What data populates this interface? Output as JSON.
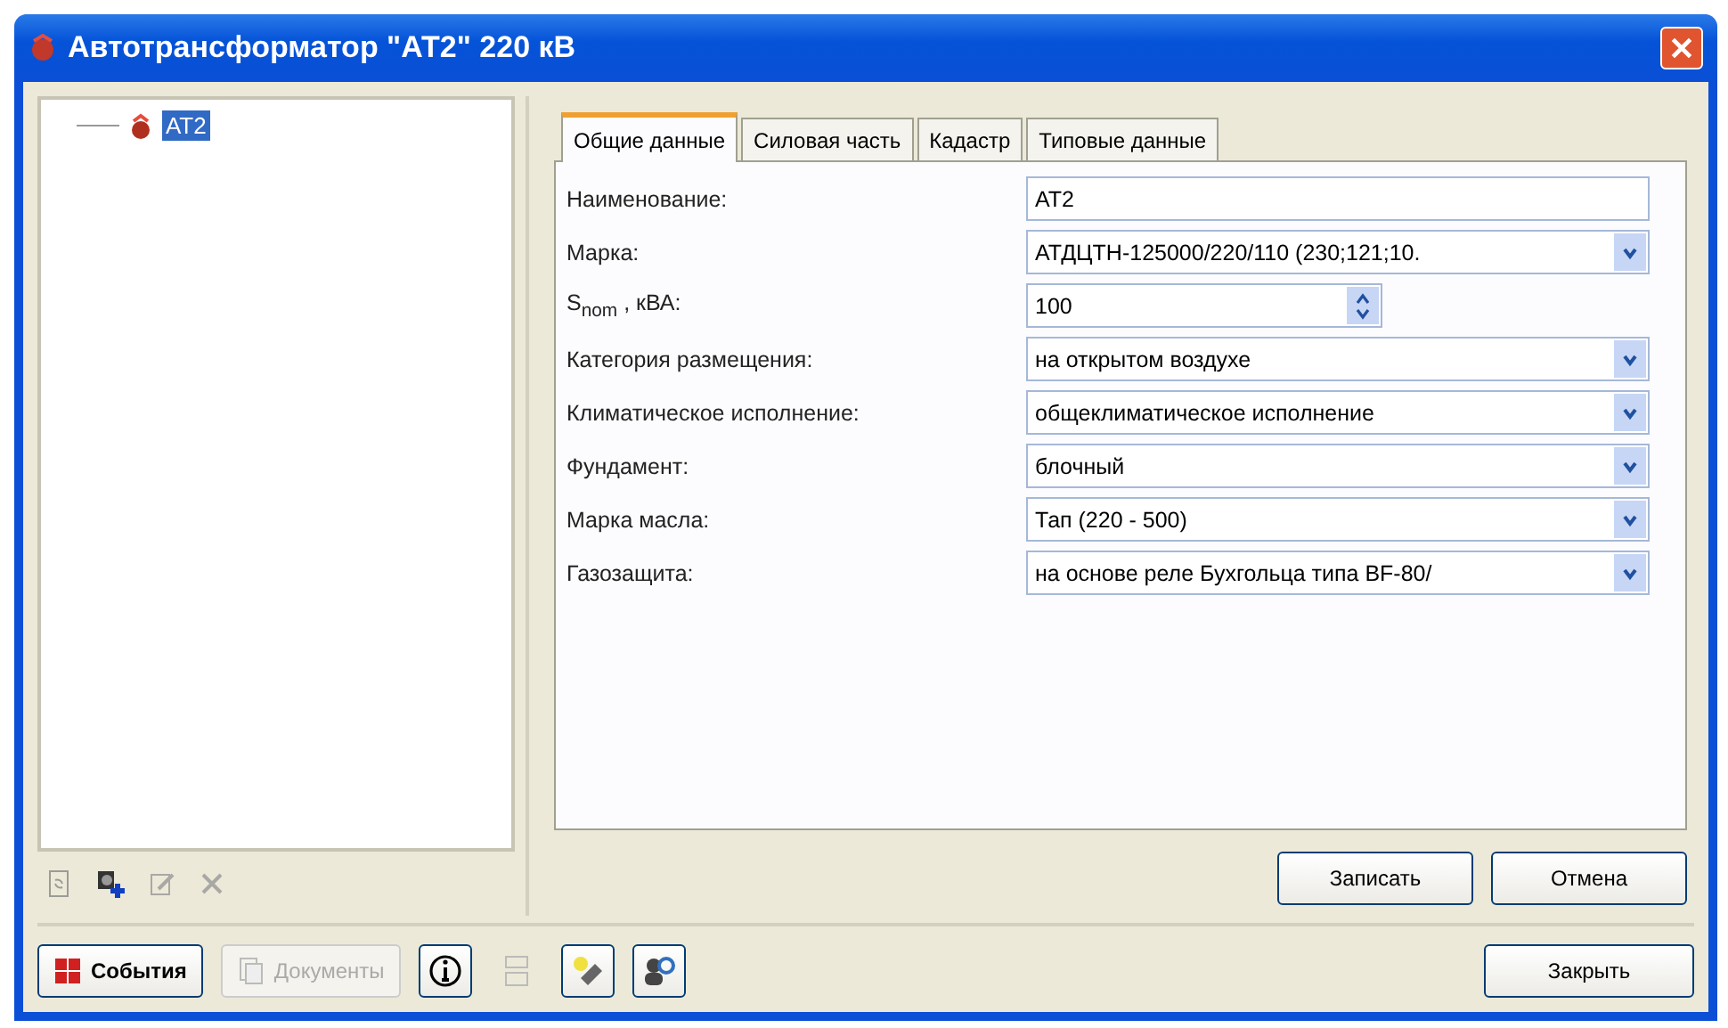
{
  "window": {
    "title": "Автотрансформатор \"АТ2\" 220 кВ"
  },
  "tree": {
    "items": [
      {
        "label": "АТ2",
        "selected": true
      }
    ]
  },
  "tree_toolbar": [
    {
      "kind": "refresh",
      "disabled": true
    },
    {
      "kind": "add",
      "disabled": false
    },
    {
      "kind": "edit",
      "disabled": true
    },
    {
      "kind": "delete",
      "disabled": true
    }
  ],
  "tabs": [
    {
      "label": "Общие данные",
      "selected": true
    },
    {
      "label": "Силовая часть",
      "selected": false
    },
    {
      "label": "Кадастр",
      "selected": false
    },
    {
      "label": "Типовые данные",
      "selected": false
    }
  ],
  "fields": [
    {
      "kind": "text",
      "label": "Наименование:",
      "value": "АТ2"
    },
    {
      "kind": "combo",
      "label": "Марка:",
      "value": "АТДЦТН-125000/220/110 (230;121;10."
    },
    {
      "kind": "spin",
      "label": "S$_{nom}$ , кВА:",
      "value": "100"
    },
    {
      "kind": "combo",
      "label": "Категория размещения:",
      "value": "на открытом воздухе"
    },
    {
      "kind": "combo",
      "label": "Климатическое исполнение:",
      "value": "общеклиматическое исполнение"
    },
    {
      "kind": "combo",
      "label": "Фундамент:",
      "value": "блочный"
    },
    {
      "kind": "combo",
      "label": "Марка масла:",
      "value": "Тап (220 - 500)"
    },
    {
      "kind": "combo",
      "label": "Газозащита:",
      "value": "на основе реле Бухгольца типа BF-80/"
    }
  ],
  "form_buttons": [
    "Записать",
    "Отмена"
  ],
  "footer_buttons": [
    {
      "kind": "events",
      "label": "События",
      "disabled": false
    },
    {
      "kind": "documents",
      "label": "Документы",
      "disabled": true
    },
    {
      "kind": "info",
      "disabled": false
    },
    {
      "kind": "layout",
      "disabled": true
    },
    {
      "kind": "tool",
      "disabled": false
    },
    {
      "kind": "user-search",
      "disabled": false
    }
  ],
  "close_button": "Закрыть"
}
